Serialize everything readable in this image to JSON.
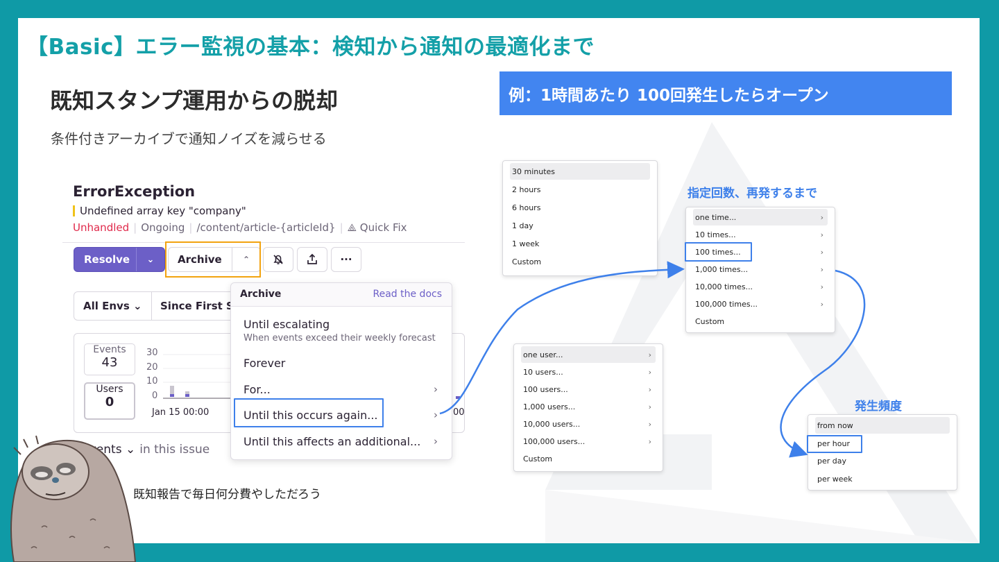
{
  "slide": {
    "title": "【Basic】エラー監視の基本：検知から通知の最適化まで",
    "subtitle": "既知スタンプ運用からの脱却",
    "description": "条件付きアーカイブで通知ノイズを減らせる",
    "banner": "例：1時間あたり 100回発生したらオープン",
    "caption": "既知報告で毎日何分費やしただろう",
    "colors": {
      "frame": "#0f9aa6",
      "title": "#14a0a8",
      "banner": "#4285f0",
      "highlight": "#3e80ea",
      "orange": "#f2a30f"
    }
  },
  "issue": {
    "title": "ErrorException",
    "message": "Undefined array key \"company\"",
    "status_unhandled": "Unhandled",
    "status_ongoing": "Ongoing",
    "path": "/content/article-{articleId}",
    "quick_fix": "Quick Fix",
    "resolve_label": "Resolve",
    "archive_label": "Archive",
    "icons": {
      "mute": "bell-off-icon",
      "share": "share-icon",
      "more": "more-icon",
      "quickfix": "quickfix-icon"
    },
    "more_label": "···",
    "env_filter": "All Envs",
    "since_filter": "Since First S",
    "events_label": "Events",
    "events_value": "43",
    "users_label": "Users",
    "users_value": "0",
    "y_ticks": [
      "30",
      "20",
      "10",
      "0"
    ],
    "x_start": "Jan 15 00:00",
    "x_end": "00",
    "events_tab": "Events",
    "events_tab_suffix": "in this issue"
  },
  "archive_menu": {
    "header": "Archive",
    "docs_link": "Read the docs",
    "items": [
      {
        "label": "Until escalating",
        "sub": "When events exceed their weekly forecast"
      },
      {
        "label": "Forever"
      },
      {
        "label": "For..."
      },
      {
        "label": "Until this occurs again..."
      },
      {
        "label": "Until this affects an additional..."
      }
    ]
  },
  "duration_menu": {
    "items": [
      "30 minutes",
      "2 hours",
      "6 hours",
      "1 day",
      "1 week",
      "Custom"
    ],
    "selected": "30 minutes"
  },
  "count_menu": {
    "label": "指定回数、再発するまで",
    "items": [
      "one time...",
      "10 times...",
      "100 times...",
      "1,000 times...",
      "10,000 times...",
      "100,000 times...",
      "Custom"
    ],
    "selected": "one time...",
    "highlighted": "100 times..."
  },
  "users_menu": {
    "items": [
      "one user...",
      "10 users...",
      "100 users...",
      "1,000 users...",
      "10,000 users...",
      "100,000 users...",
      "Custom"
    ],
    "selected": "one user..."
  },
  "window_menu": {
    "label": "発生頻度",
    "items": [
      "from now",
      "per hour",
      "per day",
      "per week"
    ],
    "selected": "from now",
    "highlighted": "per hour"
  }
}
